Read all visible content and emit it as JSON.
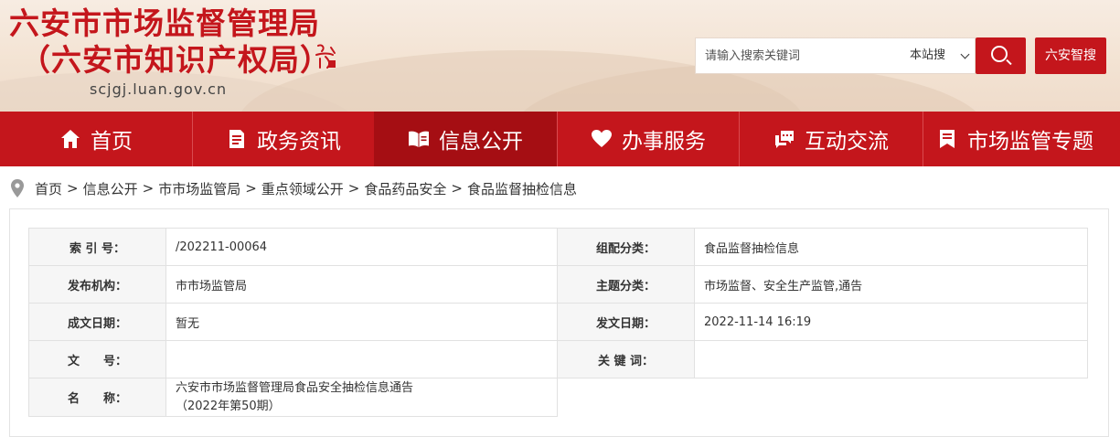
{
  "header": {
    "title_line1": "六安市市场监督管理局",
    "title_line2": "（六安市知识产权局）",
    "domain": "scjgj.luan.gov.cn",
    "seal_text": "六安市徽"
  },
  "search": {
    "placeholder": "请输入搜索关键词",
    "scope": "本站搜",
    "smart_search": "六安智搜"
  },
  "nav": {
    "items": [
      {
        "label": "首页",
        "icon": "home-icon"
      },
      {
        "label": "政务资讯",
        "icon": "document-icon"
      },
      {
        "label": "信息公开",
        "icon": "open-book-icon"
      },
      {
        "label": "办事服务",
        "icon": "heart-icon"
      },
      {
        "label": "互动交流",
        "icon": "chat-icon"
      },
      {
        "label": "市场监管专题",
        "icon": "bookmark-icon"
      }
    ],
    "active_index": 2
  },
  "breadcrumb": [
    "首页",
    "信息公开",
    "市市场监管局",
    "重点领域公开",
    "食品药品安全",
    "食品监督抽检信息"
  ],
  "meta": {
    "index_label": "索 引 号：",
    "index_value": "/202211-00064",
    "category_label": "组配分类：",
    "category_value": "食品监督抽检信息",
    "publisher_label": "发布机构：",
    "publisher_value": "市市场监管局",
    "topic_label": "主题分类：",
    "topic_value": "市场监督、安全生产监管,通告",
    "created_label": "成文日期：",
    "created_value": "暂无",
    "published_label": "发文日期：",
    "published_value": "2022-11-14 16:19",
    "docno_label": "文　　号：",
    "docno_value": "",
    "keywords_label": "关 键 词：",
    "keywords_value": "",
    "name_label": "名　　称：",
    "name_value_line1": "六安市市场监督管理局食品安全抽检信息通告",
    "name_value_line2": "（2022年第50期）"
  },
  "colors": {
    "brand_red": "#c4161c",
    "nav_active": "#a50e13"
  }
}
